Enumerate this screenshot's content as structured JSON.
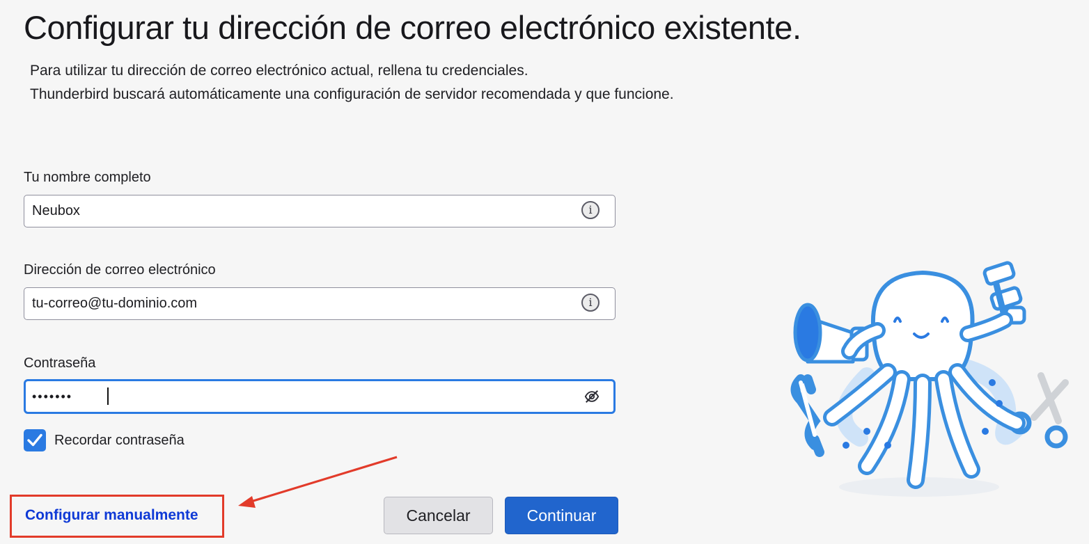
{
  "page": {
    "title": "Configurar tu dirección de correo electrónico existente.",
    "subtitle_line1": "Para utilizar tu dirección de correo electrónico actual, rellena tu credenciales.",
    "subtitle_line2": "Thunderbird buscará automáticamente una configuración de servidor recomendada y que funcione."
  },
  "form": {
    "name": {
      "label": "Tu nombre completo",
      "value": "Neubox",
      "icon": "info-icon"
    },
    "email": {
      "label": "Dirección de correo electrónico",
      "value": "tu-correo@tu-dominio.com",
      "icon": "info-icon"
    },
    "password": {
      "label": "Contraseña",
      "value": "•••••••",
      "icon": "eye-slash-icon"
    },
    "remember": {
      "label": "Recordar contraseña",
      "checked": true
    }
  },
  "actions": {
    "manual": "Configurar manualmente",
    "cancel": "Cancelar",
    "continue": "Continuar"
  },
  "colors": {
    "accent": "#2165cd",
    "focus": "#2a7ae2",
    "link": "#0f3ad6",
    "highlight": "#e23b2a"
  }
}
